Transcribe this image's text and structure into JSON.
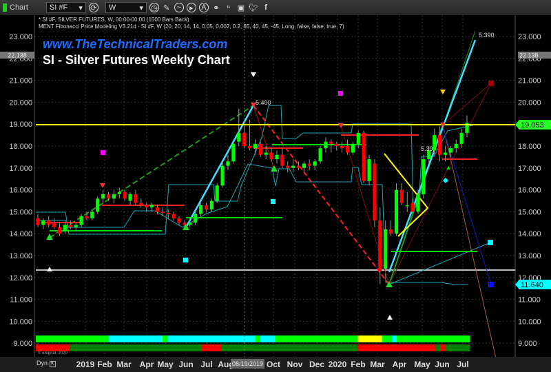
{
  "toolbar": {
    "app_label": "Chart",
    "symbol": "SI #F",
    "interval": "W"
  },
  "header": {
    "line1": "* SI #F, SILVER FUTURES, W, 00:00-00:00 (1500 Bars Back)",
    "line2": "MENT Fibonacci Price Modeling V3.21d - SI #F, W (20, 20, 14, 14, 0.05, 0.002, 0.2, 65, 40, 45, -45, Long, false, false, true, 7)"
  },
  "overlay": {
    "website": "www.TheTechnicalTraders.com",
    "title": "SI - Silver Futures Weekly Chart",
    "copyright": "© eSignal, 2020",
    "dyn": "Dyn",
    "date_tag": "08/19/2019"
  },
  "chart_data": {
    "type": "candlestick",
    "title": "SI - Silver Futures Weekly Chart",
    "ylim": [
      8.5,
      23.6
    ],
    "y_ticks": [
      "23.000",
      "22.000",
      "21.000",
      "20.000",
      "19.000",
      "18.000",
      "17.000",
      "16.000",
      "15.000",
      "14.000",
      "13.000",
      "12.000",
      "11.000",
      "10.000",
      "9.000"
    ],
    "x_ticks": [
      "2019",
      "Feb",
      "Mar",
      "Apr",
      "May",
      "Jun",
      "Jul",
      "Aug",
      "Sep",
      "Oct",
      "Nov",
      "Dec",
      "2020",
      "Feb",
      "Mar",
      "Apr",
      "May",
      "Jun",
      "Jul"
    ],
    "grid": true,
    "colors": {
      "up": "#00ff00",
      "down": "#ff0000",
      "resistance": "#ffff00",
      "support": "#c0c0c0"
    },
    "candles_ohlc": [
      [
        14.7,
        14.9,
        14.3,
        14.4
      ],
      [
        14.4,
        14.7,
        14.2,
        14.6
      ],
      [
        14.6,
        14.8,
        14.3,
        14.4
      ],
      [
        14.5,
        14.7,
        14.2,
        14.3
      ],
      [
        14.3,
        14.5,
        13.9,
        14.0
      ],
      [
        14.1,
        14.5,
        14.0,
        14.4
      ],
      [
        14.4,
        14.6,
        14.2,
        14.3
      ],
      [
        14.3,
        14.5,
        14.1,
        14.4
      ],
      [
        14.4,
        14.9,
        14.3,
        14.8
      ],
      [
        14.8,
        15.0,
        14.6,
        14.7
      ],
      [
        14.7,
        15.1,
        14.6,
        15.0
      ],
      [
        15.0,
        15.7,
        14.9,
        15.6
      ],
      [
        15.6,
        16.0,
        15.4,
        15.8
      ],
      [
        15.8,
        15.9,
        15.5,
        15.6
      ],
      [
        15.6,
        16.0,
        15.4,
        15.8
      ],
      [
        15.8,
        16.1,
        15.6,
        15.9
      ],
      [
        15.9,
        16.0,
        15.5,
        15.6
      ],
      [
        15.5,
        15.9,
        15.3,
        15.8
      ],
      [
        15.8,
        16.0,
        15.3,
        15.4
      ],
      [
        15.4,
        15.6,
        15.2,
        15.3
      ],
      [
        15.3,
        15.4,
        15.0,
        15.2
      ],
      [
        15.2,
        15.4,
        15.0,
        15.3
      ],
      [
        15.2,
        15.3,
        14.9,
        15.0
      ],
      [
        15.0,
        15.2,
        14.8,
        14.95
      ],
      [
        14.95,
        15.1,
        14.7,
        14.9
      ],
      [
        14.9,
        15.0,
        14.6,
        14.7
      ],
      [
        14.7,
        14.8,
        14.4,
        14.5
      ],
      [
        14.5,
        14.6,
        14.3,
        14.4
      ],
      [
        14.4,
        14.6,
        14.3,
        14.5
      ],
      [
        14.5,
        15.0,
        14.4,
        14.9
      ],
      [
        14.9,
        15.4,
        14.8,
        15.3
      ],
      [
        15.3,
        15.4,
        15.0,
        15.1
      ],
      [
        15.1,
        15.6,
        15.0,
        15.5
      ],
      [
        15.5,
        16.3,
        15.4,
        16.2
      ],
      [
        16.2,
        17.3,
        16.1,
        17.1
      ],
      [
        17.1,
        17.6,
        16.9,
        17.3
      ],
      [
        17.3,
        18.2,
        17.2,
        18.1
      ],
      [
        18.2,
        19.7,
        18.0,
        18.6
      ],
      [
        18.6,
        18.9,
        17.9,
        18.0
      ],
      [
        18.0,
        19.2,
        17.8,
        17.9
      ],
      [
        17.9,
        18.3,
        17.6,
        18.1
      ],
      [
        18.1,
        18.2,
        17.5,
        17.6
      ],
      [
        17.6,
        18.0,
        17.4,
        17.7
      ],
      [
        17.7,
        17.9,
        17.3,
        17.4
      ],
      [
        17.4,
        17.8,
        17.2,
        17.6
      ],
      [
        17.6,
        17.9,
        17.0,
        17.1
      ],
      [
        17.1,
        17.3,
        16.8,
        17.0
      ],
      [
        17.0,
        17.4,
        16.8,
        17.1
      ],
      [
        17.1,
        17.3,
        16.9,
        17.0
      ],
      [
        17.0,
        17.3,
        16.8,
        17.2
      ],
      [
        17.2,
        17.4,
        16.9,
        17.1
      ],
      [
        17.1,
        17.4,
        16.9,
        17.3
      ],
      [
        17.3,
        18.0,
        17.2,
        17.9
      ],
      [
        17.9,
        18.4,
        17.7,
        18.2
      ],
      [
        18.2,
        18.3,
        17.7,
        18.1
      ],
      [
        18.1,
        18.2,
        17.8,
        18.0
      ],
      [
        18.0,
        18.2,
        17.7,
        17.9
      ],
      [
        18.0,
        18.3,
        17.6,
        17.7
      ],
      [
        17.7,
        18.2,
        17.6,
        18.1
      ],
      [
        18.1,
        18.7,
        17.9,
        18.6
      ],
      [
        18.6,
        18.7,
        16.3,
        16.4
      ],
      [
        16.4,
        17.6,
        16.2,
        17.4
      ],
      [
        17.2,
        17.4,
        14.3,
        14.6
      ],
      [
        14.6,
        15.2,
        11.7,
        12.3
      ],
      [
        12.4,
        14.6,
        12.3,
        14.2
      ],
      [
        14.2,
        14.6,
        13.9,
        14.0
      ],
      [
        14.0,
        16.3,
        13.9,
        16.0
      ],
      [
        16.0,
        16.3,
        15.3,
        15.4
      ],
      [
        15.3,
        15.9,
        15.0,
        15.3
      ],
      [
        15.4,
        15.6,
        14.9,
        15.0
      ],
      [
        15.0,
        16.0,
        14.9,
        15.8
      ],
      [
        15.8,
        17.6,
        15.6,
        17.4
      ],
      [
        17.4,
        18.0,
        17.2,
        17.8
      ],
      [
        17.8,
        18.8,
        17.6,
        18.5
      ],
      [
        18.5,
        18.9,
        17.3,
        17.6
      ],
      [
        17.6,
        18.0,
        17.3,
        17.7
      ],
      [
        17.7,
        18.0,
        17.5,
        17.9
      ],
      [
        17.9,
        18.3,
        17.7,
        18.1
      ],
      [
        18.1,
        18.8,
        17.9,
        18.6
      ],
      [
        18.6,
        19.4,
        18.4,
        19.053
      ]
    ],
    "levels": {
      "resistance": 18.95,
      "support": 12.38
    },
    "price_labels": {
      "last": "19.053",
      "target_low": "11.640",
      "prior_high": "22.138"
    },
    "annotations": [
      "5.400",
      "5.390",
      "5.39"
    ],
    "trend_strip_top": [
      [
        "#00ff00",
        15
      ],
      [
        "#00ffff",
        11
      ],
      [
        "#00ff00",
        1
      ],
      [
        "#00ffff",
        18
      ],
      [
        "#00ff00",
        1
      ],
      [
        "#00ffff",
        3
      ],
      [
        "#00ff00",
        17
      ],
      [
        "#ffff00",
        5
      ],
      [
        "#00ff00",
        2
      ],
      [
        "#00ffff",
        1
      ],
      [
        "#00ff00",
        15
      ]
    ],
    "trend_strip_bottom": [
      [
        "#ff0000",
        7
      ],
      [
        "#008000",
        27
      ],
      [
        "#ff0000",
        4
      ],
      [
        "#008000",
        28
      ],
      [
        "#ff0000",
        16
      ],
      [
        "#008000",
        1
      ],
      [
        "#ff0000",
        1
      ],
      [
        "#008000",
        5
      ]
    ]
  }
}
